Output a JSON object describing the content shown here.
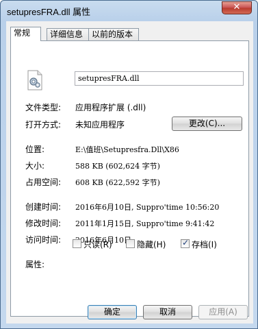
{
  "window": {
    "title": "setupresFRA.dll 属性",
    "close_label": "✕"
  },
  "tabs": [
    {
      "label": "常规"
    },
    {
      "label": "详细信息"
    },
    {
      "label": "以前的版本"
    }
  ],
  "general": {
    "file_name": "setupresFRA.dll",
    "icon": "dll-file-icon",
    "file_type_label": "文件类型:",
    "file_type_value": "应用程序扩展 (.dll)",
    "open_with_label": "打开方式:",
    "open_with_value": "未知应用程序",
    "change_button": "更改(C)...",
    "location_label": "位置:",
    "location_value": "E:\\值班\\Setupresfra.Dll\\X86",
    "size_label": "大小:",
    "size_value": "588 KB (602,624 字节)",
    "size_on_disk_label": "占用空间:",
    "size_on_disk_value": "608 KB (622,592 字节)",
    "created_label": "创建时间:",
    "created_value": "2016年6月10日, Suppro'time 10:56:20",
    "modified_label": "修改时间:",
    "modified_value": "2011年1月15日, Suppro'time 9:41:42",
    "accessed_label": "访问时间:",
    "accessed_value": "2016年6月10日",
    "attributes_label": "属性:",
    "attributes": [
      {
        "label": "只读(R)",
        "checked": false
      },
      {
        "label": "隐藏(H)",
        "checked": false
      },
      {
        "label": "存档(I)",
        "checked": true
      }
    ]
  },
  "buttons": {
    "ok": "确定",
    "cancel": "取消",
    "apply": "应用(A)"
  }
}
